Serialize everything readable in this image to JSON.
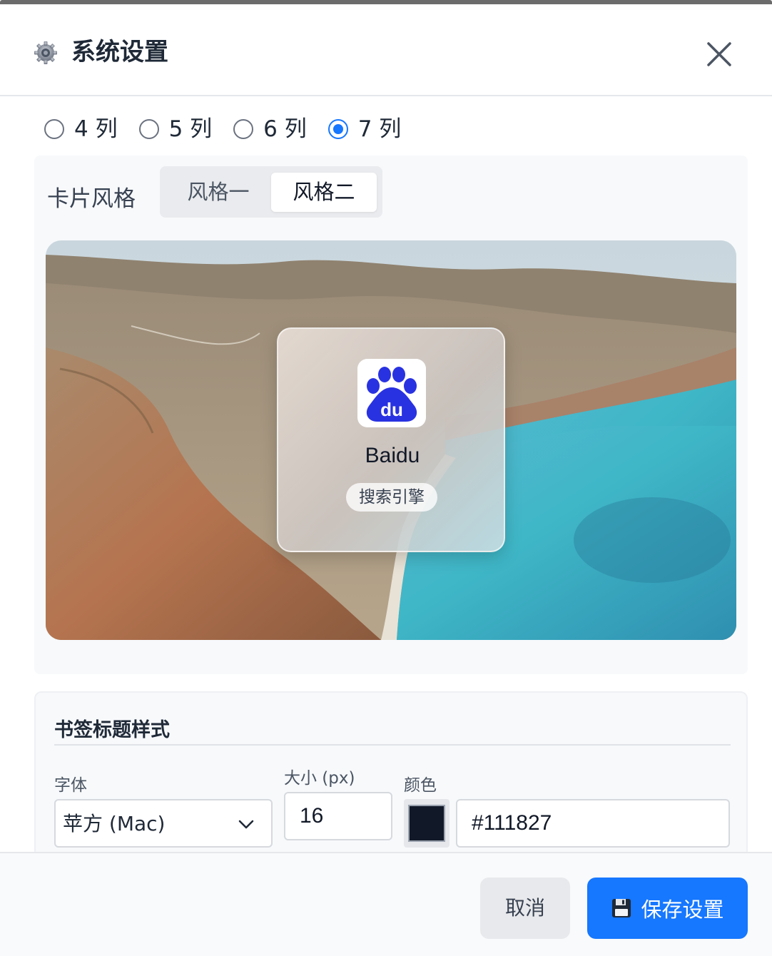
{
  "dialog": {
    "title": "系统设置",
    "icons": {
      "settings": "gear-icon",
      "close": "close-icon"
    }
  },
  "columns": {
    "options": [
      "4 列",
      "5 列",
      "6 列",
      "7 列"
    ],
    "selected": "7 列"
  },
  "card_style": {
    "label": "卡片风格",
    "options": [
      "风格一",
      "风格二"
    ],
    "selected": "风格二"
  },
  "preview": {
    "bookmark": {
      "icon": "baidu-paw-logo",
      "icon_text": "du",
      "name": "Baidu",
      "tag": "搜索引擎"
    }
  },
  "title_style": {
    "heading": "书签标题样式",
    "font_label": "字体",
    "font_value": "苹方 (Mac)",
    "size_label": "大小 (px)",
    "size_value": "16",
    "color_label": "颜色",
    "color_value": "#111827"
  },
  "footer": {
    "cancel_label": "取消",
    "save_label": "保存设置",
    "save_icon": "floppy-disk-icon"
  },
  "colors": {
    "accent": "#1677ff",
    "title_color": "#111827"
  }
}
